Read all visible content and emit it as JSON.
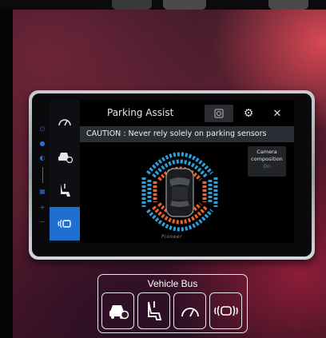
{
  "header": {
    "title": "Parking Assist",
    "caution": "CAUTION : Never rely solely on parking sensors"
  },
  "camera_composition": {
    "label_line1": "Camera",
    "label_line2": "composition",
    "state": "On"
  },
  "brand": "Pioneer",
  "vehicle_bus": {
    "label": "Vehicle Bus"
  },
  "colors": {
    "accent": "#1e6fd0",
    "sensor_near": "#e8642a",
    "sensor_far": "#2a9fd8",
    "caution_bg": "#2a2e35"
  },
  "menu": [
    {
      "icon": "gauge-icon",
      "active": false
    },
    {
      "icon": "car-settings-icon",
      "active": false
    },
    {
      "icon": "seat-icon",
      "active": false
    },
    {
      "icon": "parking-sensor-icon",
      "active": true
    }
  ],
  "bus_icons": [
    "car-settings-icon",
    "seat-icon",
    "gauge-icon",
    "parking-sensor-icon"
  ]
}
